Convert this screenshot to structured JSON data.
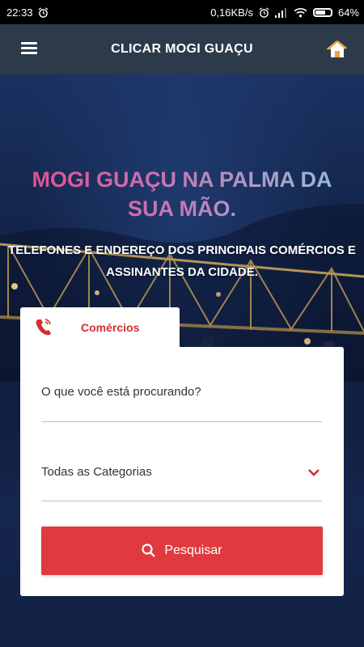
{
  "status_bar": {
    "time": "22:33",
    "speed": "0,16KB/s",
    "battery": "64%",
    "battery_level": 0.64
  },
  "app_bar": {
    "title": "CLICAR MOGI GUAÇU",
    "menu_icon": "hamburger-menu-icon",
    "home_icon": "home-icon"
  },
  "hero": {
    "headline": "MOGI GUAÇU NA PALMA DA SUA MÃO.",
    "subline": "TELEFONES E ENDEREÇO DOS PRINCIPAIS COMÉRCIOS E ASSINANTES DA CIDADE."
  },
  "tab": {
    "label": "Comércios",
    "icon": "phone-icon"
  },
  "form": {
    "search_placeholder": "O que você está procurando?",
    "category_selected": "Todas as Categorias",
    "search_button": "Pesquisar"
  },
  "colors": {
    "accent": "#e03a3e",
    "app_bar": "#2d3a4a",
    "headline_start": "#e84a8c",
    "headline_end": "#8ec6d6"
  }
}
